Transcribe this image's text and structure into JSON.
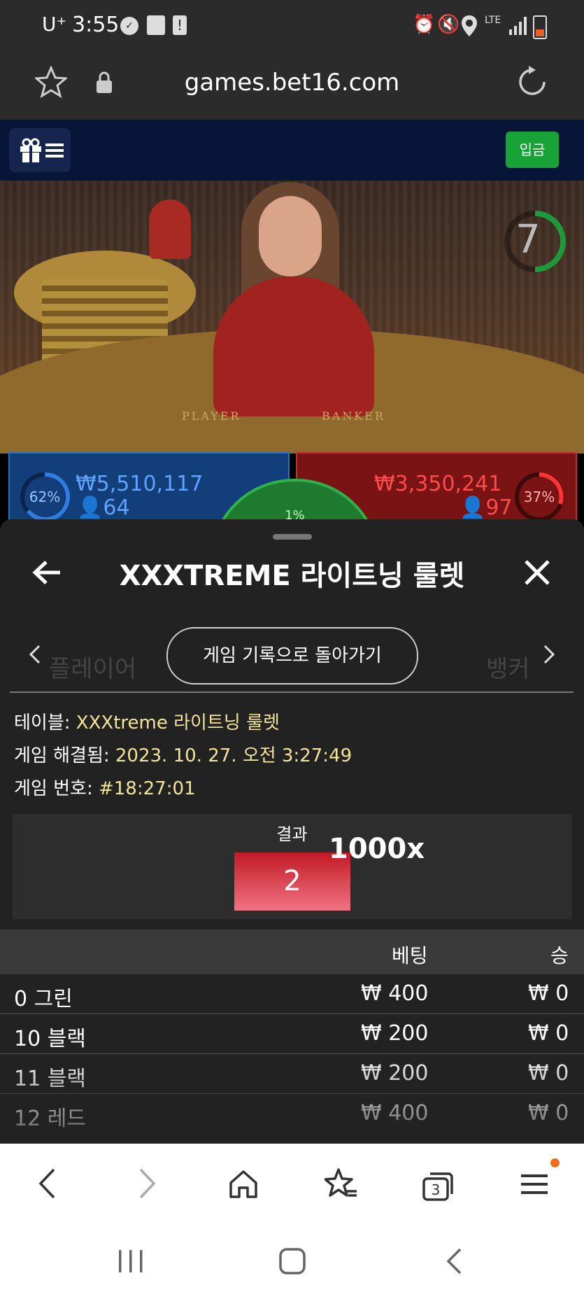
{
  "status_bar": {
    "carrier": "U⁺",
    "time": "3:55",
    "network": "LTE"
  },
  "browser": {
    "url": "games.bet16.com",
    "tab_count": "3"
  },
  "site_header": {
    "deposit_label": "입금"
  },
  "video": {
    "timer": "7",
    "table_player_text": "PLAYER",
    "table_banker_text": "BANKER"
  },
  "bets": {
    "player_pct": "62%",
    "player_amount": "₩5,510,117",
    "player_count": "64",
    "banker_pct": "37%",
    "banker_amount": "₩3,350,241",
    "banker_count": "97",
    "tie_pct": "1%"
  },
  "modal": {
    "title": "XXXTREME 라이트닝 룰렛",
    "history_button": "게임 기록으로 돌아가기",
    "info": {
      "table_label": "테이블:",
      "table_value": "XXXtreme 라이트닝 룰렛",
      "resolved_label": "게임 해결됨:",
      "resolved_value": "2023. 10. 27. 오전 3:27:49",
      "number_label": "게임 번호:",
      "number_value": "#18:27:01"
    },
    "result_label": "결과",
    "result_value": "2",
    "multiplier": "1000x",
    "table_headers": {
      "bet": "베팅",
      "win": "승"
    },
    "rows": [
      {
        "name": "0 그린",
        "bet": "₩ 400",
        "win": "₩ 0"
      },
      {
        "name": "10 블랙",
        "bet": "₩ 200",
        "win": "₩ 0"
      },
      {
        "name": "11 블랙",
        "bet": "₩ 200",
        "win": "₩ 0"
      },
      {
        "name": "12 레드",
        "bet": "₩ 400",
        "win": "₩ 0"
      }
    ]
  },
  "colors": {
    "deposit_green": "#18a338",
    "result_red": "#c01a24",
    "info_value": "#f2e59a"
  }
}
